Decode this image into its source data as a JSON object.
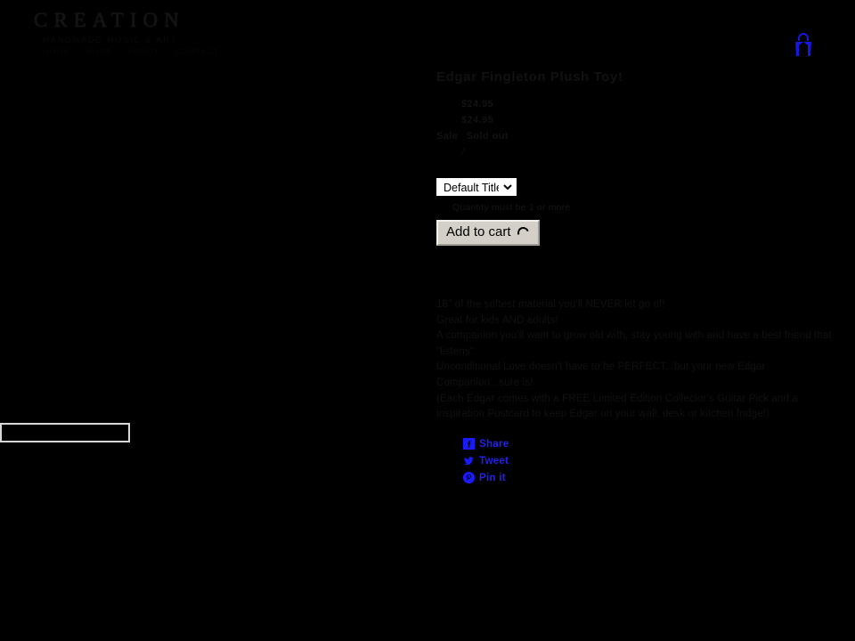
{
  "header": {
    "logo_text": "CREATION",
    "tagline": "HANDMADE MUSIC & ART",
    "nav": [
      "HOME",
      "SHOP",
      "ABOUT",
      "CONTACT"
    ],
    "cart_icon": "shopping-bag-icon",
    "cart_accent_color": "#1a1aff"
  },
  "gallery": {
    "main_image_alt": "",
    "thumbnail_strip_alt": ""
  },
  "product": {
    "title": "Edgar Fingleton Plush Toy!",
    "price": "$24.95",
    "compare_at_price": "$24.95",
    "sale_badge": "Sale",
    "sold_out_badge": "Sold out",
    "unit_price_separator": "/",
    "variant_label": "Default Title",
    "variant_options": [
      "Default Title"
    ],
    "quantity_error": "Quantity must be 1 or more",
    "add_to_cart_label": "Add to cart",
    "loading_indicator": "spinner-icon"
  },
  "description": {
    "lines": [
      "18\" of the softest material you'll NEVER let go of!",
      "Great for kids AND adults!",
      "A companion you'll want to grow old with, stay young with and have a best friend that \"listens\".",
      "Unconditional Love doesn't have to be PERFECT...but your new Edgar Companion...sure is!",
      "(Each Edgar comes with a FREE Limited Edition Collector's Guitar Pick and a inspiration Postcard to keep Edgar on your wall, desk or kitchen fridge!)"
    ]
  },
  "share": {
    "items": [
      {
        "label": "Share",
        "icon": "facebook-icon"
      },
      {
        "label": "Tweet",
        "icon": "twitter-icon"
      },
      {
        "label": "Pin it",
        "icon": "pinterest-icon"
      }
    ],
    "link_color": "#2222ee"
  }
}
